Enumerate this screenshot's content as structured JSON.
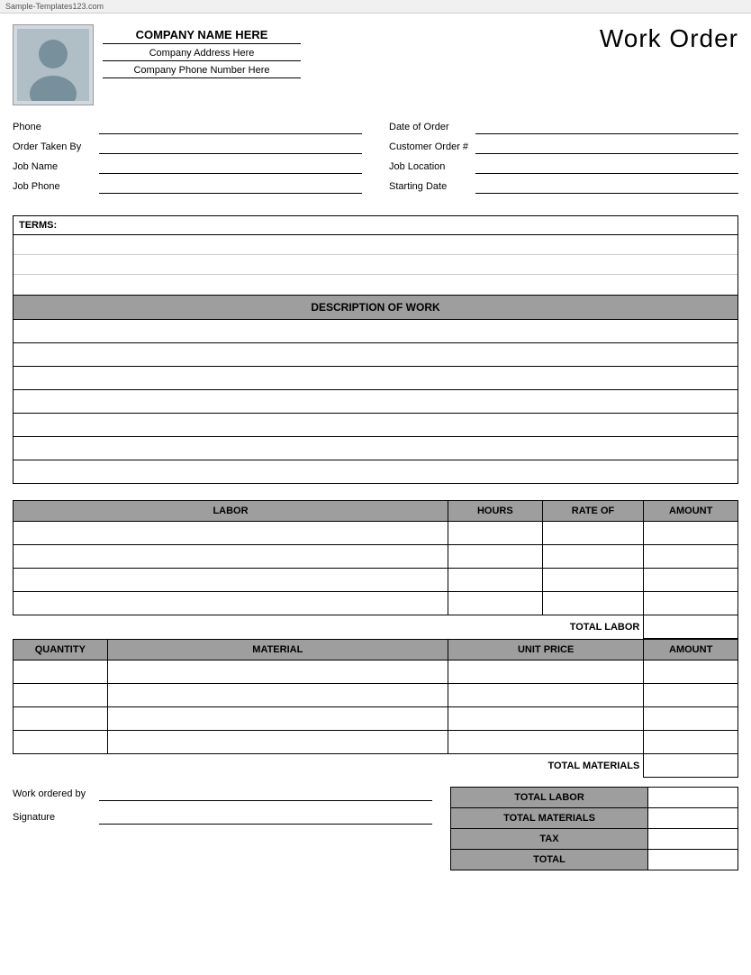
{
  "watermark": {
    "text": "Sample-Templates123.com"
  },
  "header": {
    "company_name": "COMPANY NAME HERE",
    "company_address": "Company Address Here",
    "company_phone": "Company Phone Number Here",
    "title": "Work Order"
  },
  "form": {
    "left": [
      {
        "label": "Phone",
        "value": ""
      },
      {
        "label": "Order Taken By",
        "value": ""
      },
      {
        "label": "Job Name",
        "value": ""
      },
      {
        "label": "Job Phone",
        "value": ""
      }
    ],
    "right": [
      {
        "label": "Date of Order",
        "value": ""
      },
      {
        "label": "Customer Order #",
        "value": ""
      },
      {
        "label": "Job Location",
        "value": ""
      },
      {
        "label": "Starting Date",
        "value": ""
      }
    ]
  },
  "terms": {
    "label": "TERMS:",
    "rows": 3
  },
  "description": {
    "header": "DESCRIPTION OF WORK",
    "rows": 7
  },
  "labor": {
    "columns": [
      "LABOR",
      "HOURS",
      "RATE OF",
      "AMOUNT"
    ],
    "rows": 4,
    "total_label": "TOTAL LABOR"
  },
  "materials": {
    "columns": [
      "QUANTITY",
      "MATERIAL",
      "UNIT PRICE",
      "AMOUNT"
    ],
    "rows": 4,
    "total_label": "TOTAL MATERIALS"
  },
  "summary": {
    "rows": [
      {
        "label": "TOTAL LABOR",
        "value": ""
      },
      {
        "label": "TOTAL MATERIALS",
        "value": ""
      },
      {
        "label": "TAX",
        "value": ""
      },
      {
        "label": "TOTAL",
        "value": ""
      }
    ]
  },
  "signature": {
    "work_ordered_by": "Work ordered by",
    "signature": "Signature"
  }
}
